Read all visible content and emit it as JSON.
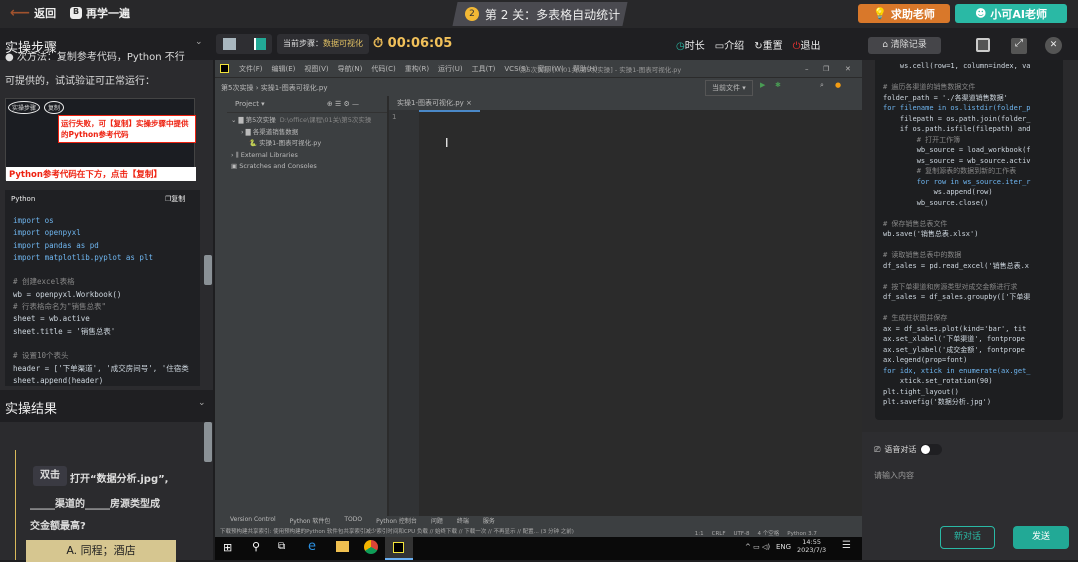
{
  "topbar": {
    "back": "返回",
    "relearn": "再学一遍",
    "level_num": "2",
    "level_title": "第 2 关：多表格自动统计",
    "help_teacher": "求助老师",
    "ai_teacher": "小可AI老师"
  },
  "toolbar": {
    "steps_title": "实操步骤",
    "current_step_label": "当前步骤：",
    "current_step": "数据可视化",
    "timer": "00:06:05",
    "duration": "时长",
    "intro": "介绍",
    "reset": "重置",
    "exit": "退出",
    "clear_records": "清除记录"
  },
  "left": {
    "intro_line1": "● 次方法：复制参考代码，Python 不行",
    "intro_line2": "可提供的，试试验证可正常运行：",
    "guide_callout": "运行失败，可【复制】实操步骤中提供的Python参考代码",
    "guide_bottom": "Python参考代码在下方，点击【复制】",
    "guide_labels": [
      "实操步骤",
      "复制"
    ],
    "code_lang": "Python",
    "copy_label": "复制",
    "code_lines": [
      "import os",
      "import openpyxl",
      "import pandas as pd",
      "import matplotlib.pyplot as plt",
      "",
      "# 创建excel表格",
      "wb = openpyxl.Workbook()",
      "# 行表格命名为\"销售总表\"",
      "sheet = wb.active",
      "sheet.title = '销售总表'",
      "",
      "# 设置10个表头",
      "header = ['下单渠道', '成交房间号', '住宿类",
      "sheet.append(header)"
    ],
    "result_title": "实操结果",
    "dbl_click": "双击",
    "question_p1": "打开“数据分析.jpg”,",
    "question_p2": "_____渠道的_____房源类型成",
    "question_p3": "交金额最高?",
    "option_a": "A. 同程；酒店"
  },
  "ide": {
    "menu": [
      "文件(F)",
      "编辑(E)",
      "视图(V)",
      "导航(N)",
      "代码(C)",
      "重构(R)",
      "运行(U)",
      "工具(T)",
      "VCS(S)",
      "窗口(W)",
      "帮助(H)"
    ],
    "window_title": "第5次实操 [...\\01关\\第5次实操] - 实操1-图表可视化.py",
    "breadcrumb": [
      "第5次实操",
      "实操1-图表可视化.py"
    ],
    "project_label": "Project",
    "run_config": "当前文件",
    "tree": [
      {
        "label": "第5次实操",
        "path": "D:\\office\\课程\\01关\\第5次实操"
      },
      {
        "label": "各渠道销售数据"
      },
      {
        "label": "实操1-图表可视化.py"
      },
      {
        "label": "External Libraries"
      },
      {
        "label": "Scratches and Consoles"
      }
    ],
    "tab": "实操1-图表可视化.py",
    "line_no": "1",
    "bottom_tabs": [
      "Version Control",
      "Python 软件包",
      "TODO",
      "Python 控制台",
      "问题",
      "终端",
      "服务"
    ],
    "status_msg": "下载预构建共享索引: 使用预构建的Python 软件包共享索引减少索引时间和CPU 负载 // 始终下载 // 下载一次 // 不再显示 // 配置... (3 分钟 之前)",
    "status_right": [
      "1:1",
      "CRLF",
      "UTF-8",
      "4 个空格",
      "Python 3.7"
    ]
  },
  "taskbar": {
    "lang": "ENG",
    "time": "14:55",
    "date": "2023/7/3"
  },
  "right": {
    "code_lines": [
      "    ws.cell(row=1, column=index, va",
      "",
      "# 遍历各渠道的销售数据文件",
      "folder_path = './各渠道销售数据'",
      "for filename in os.listdir(folder_p",
      "    filepath = os.path.join(folder_",
      "    if os.path.isfile(filepath) and",
      "        # 打开工作簿",
      "        wb_source = load_workbook(f",
      "        ws_source = wb_source.activ",
      "        # 复制源表的数据到新的工作表",
      "        for row in ws_source.iter_r",
      "            ws.append(row)",
      "        wb_source.close()",
      "",
      "# 保存销售总表文件",
      "wb.save('销售总表.xlsx')",
      "",
      "# 读取销售总表中的数据",
      "df_sales = pd.read_excel('销售总表.x",
      "",
      "# 按下单渠道和房源类型对成交金额进行求",
      "df_sales = df_sales.groupby(['下单渠",
      "",
      "# 生成柱状图并保存",
      "ax = df_sales.plot(kind='bar', tit",
      "ax.set_xlabel('下单渠道', fontprope",
      "ax.set_ylabel('成交金额', fontprope",
      "ax.legend(prop=font)",
      "for idx, xtick in enumerate(ax.get_",
      "    xtick.set_rotation(90)",
      "plt.tight_layout()",
      "plt.savefig('数据分析.jpg')"
    ],
    "voice_label": "语音对话",
    "voice_on": false,
    "input_placeholder": "请输入内容",
    "new_chat": "新对话",
    "send": "发送"
  }
}
